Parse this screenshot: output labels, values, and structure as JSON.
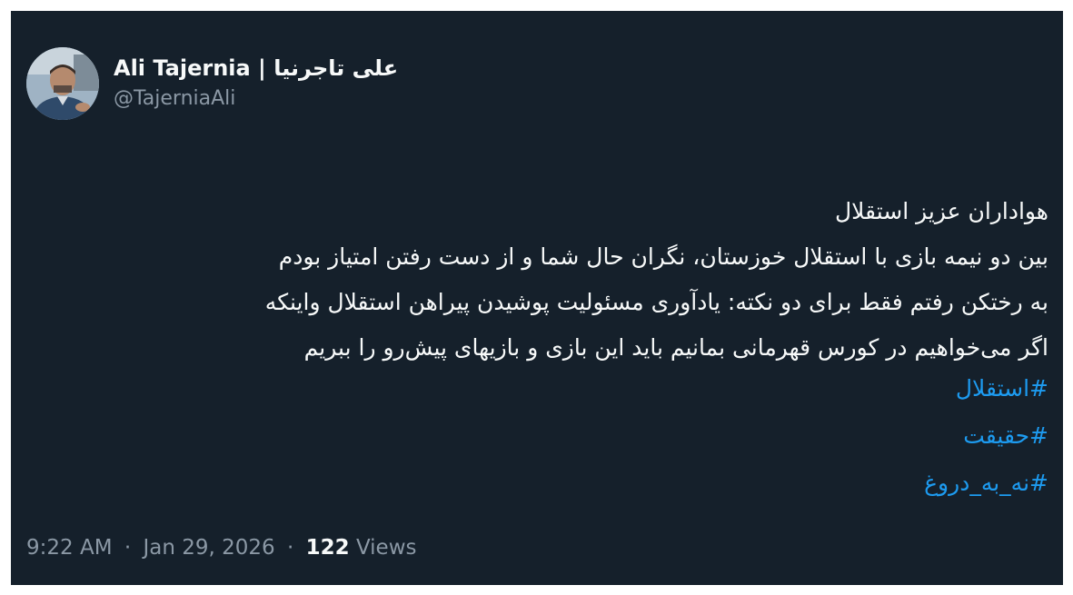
{
  "author": {
    "display_name": "Ali Tajernia | علی تاجرنیا",
    "handle": "@TajerniaAli"
  },
  "tweet": {
    "lines": [
      "هواداران عزیز استقلال",
      "بین دو نیمه بازی با استقلال خوزستان، نگران حال شما و از دست رفتن امتیاز بودم",
      "به رختکن رفتم فقط برای دو نکته: یادآوری مسئولیت پوشیدن پیراهن استقلال واینکه",
      "اگر می‌خواهیم در کورس قهرمانی بمانیم باید این بازی و بازیهای پیش‌رو را ببریم"
    ],
    "hashtags": [
      "#استقلال",
      "#حقیقت",
      "#نه_به_دروغ"
    ]
  },
  "meta": {
    "time": "9:22 AM",
    "separator": "·",
    "date": "Jan 29, 2026",
    "views_count": "122",
    "views_label": "Views"
  },
  "colors": {
    "background": "#15202b",
    "text": "#f7f9f9",
    "secondary": "#8b98a5",
    "link": "#1d9bf0"
  }
}
